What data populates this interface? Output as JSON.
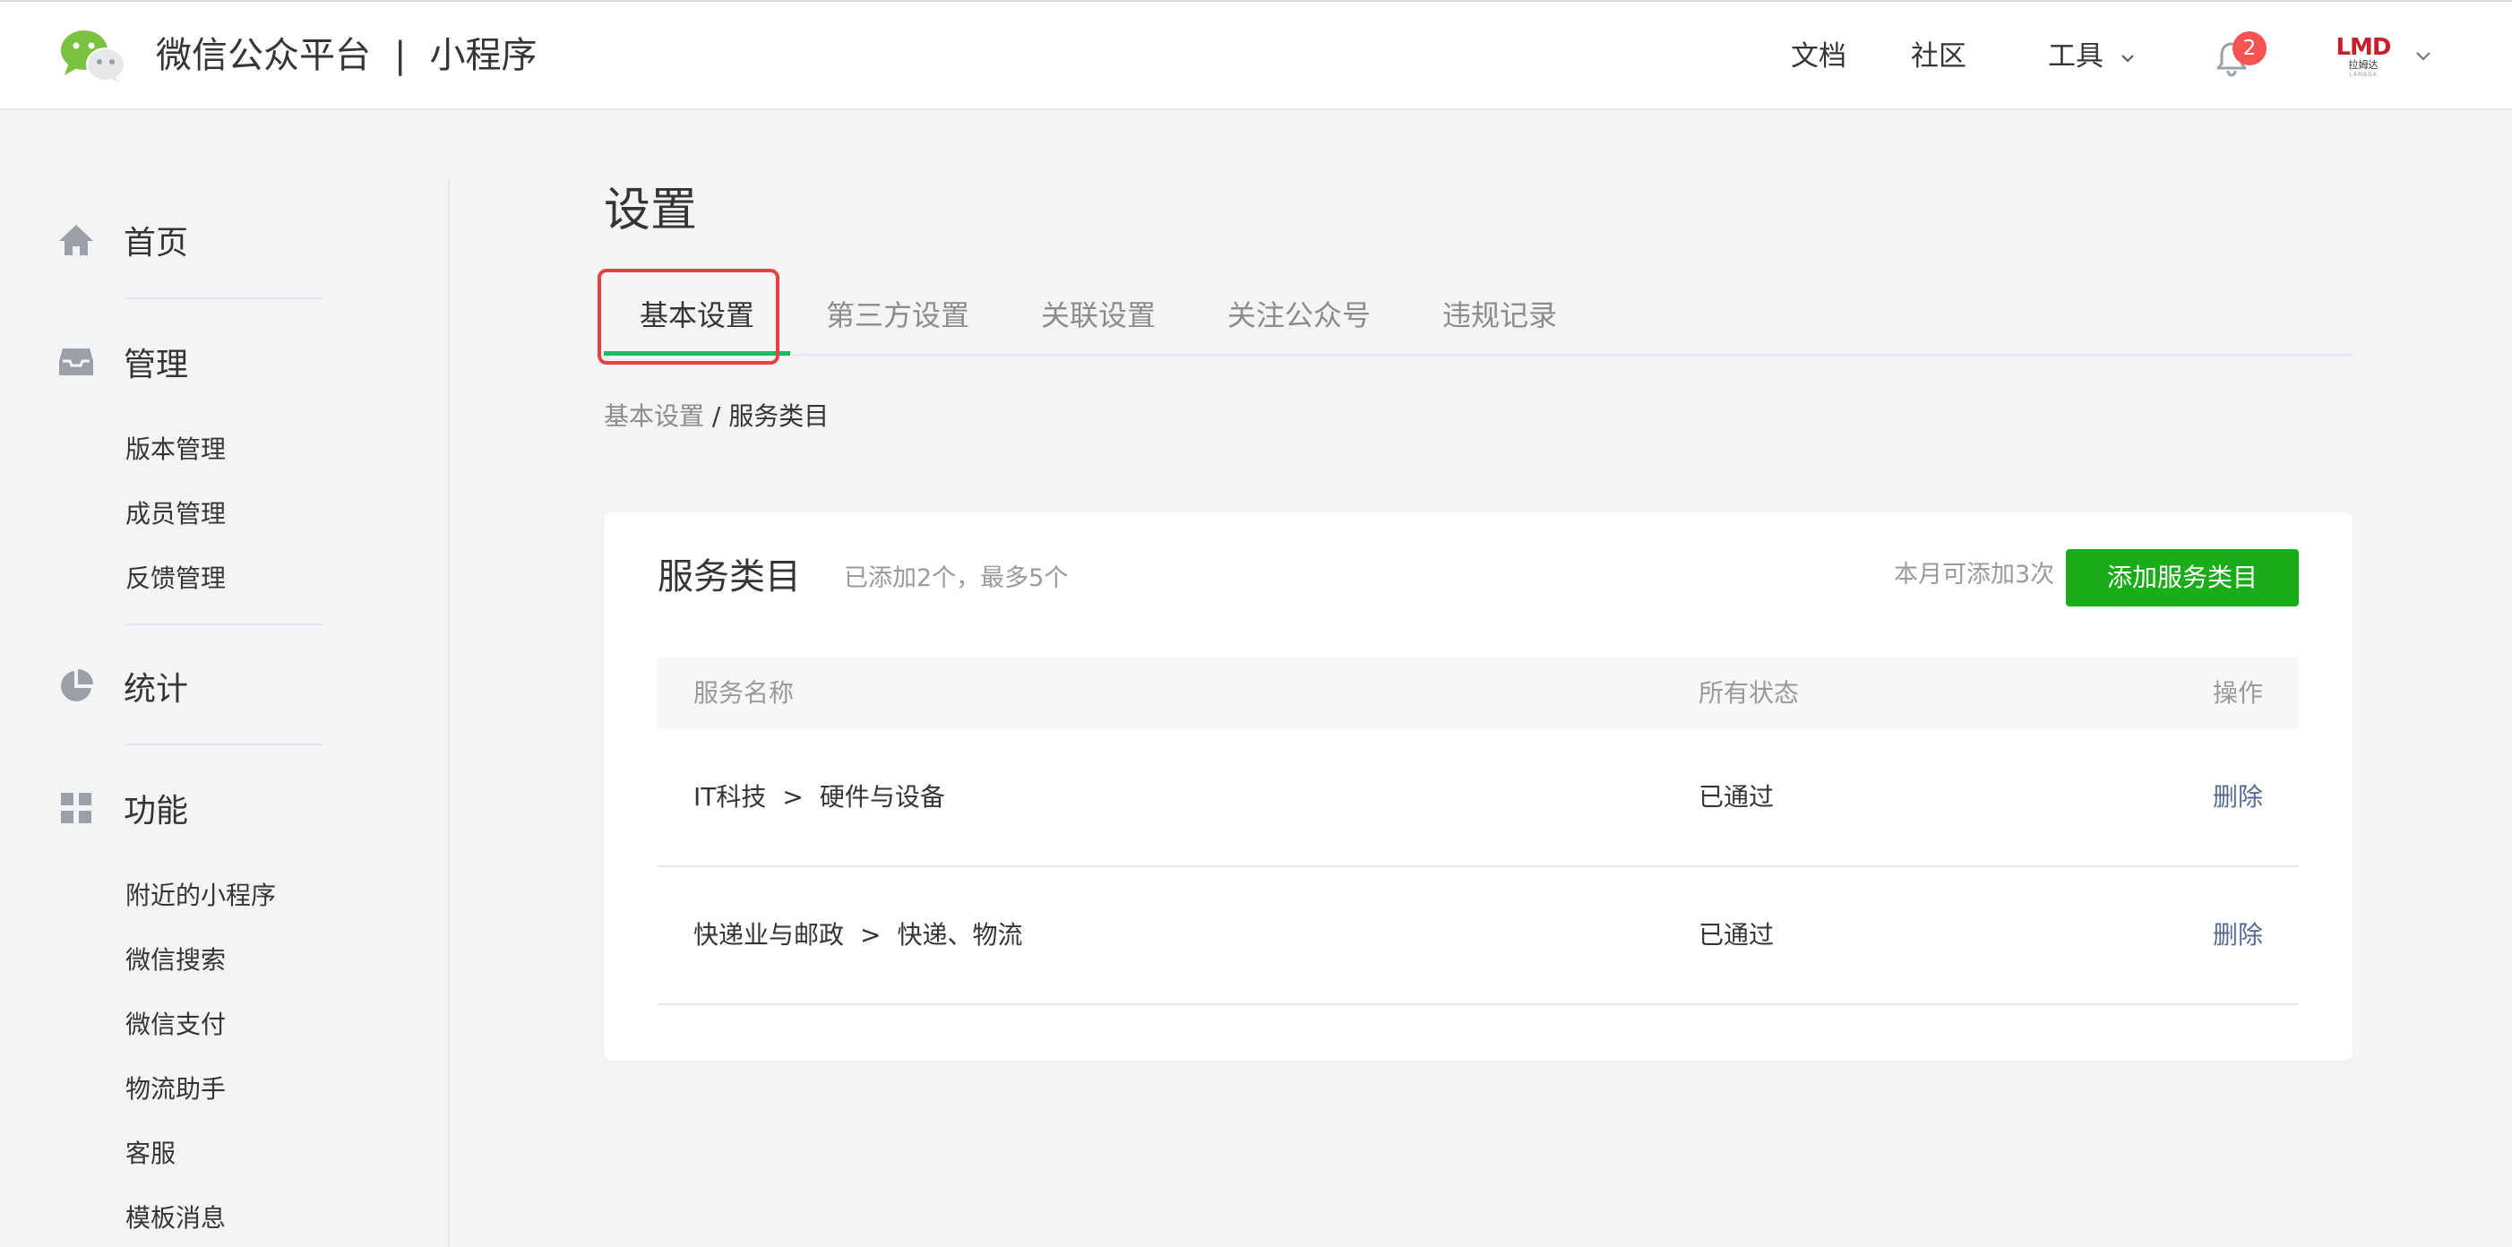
{
  "header": {
    "brand_title": "微信公众平台",
    "brand_sep": "|",
    "brand_product": "小程序",
    "nav": {
      "docs": "文档",
      "community": "社区",
      "tools": "工具"
    },
    "notifications_count": "2",
    "account_logo_text": "LMD",
    "account_logo_sub": "拉姆达",
    "account_logo_sub2": "LAMBDA"
  },
  "sidebar": {
    "home": "首页",
    "manage": "管理",
    "manage_items": [
      "版本管理",
      "成员管理",
      "反馈管理"
    ],
    "stats": "统计",
    "features": "功能",
    "feature_items": [
      "附近的小程序",
      "微信搜索",
      "微信支付",
      "物流助手",
      "客服",
      "模板消息"
    ]
  },
  "main": {
    "page_title": "设置",
    "tabs": [
      {
        "label": "基本设置",
        "active": true
      },
      {
        "label": "第三方设置",
        "active": false
      },
      {
        "label": "关联设置",
        "active": false
      },
      {
        "label": "关注公众号",
        "active": false
      },
      {
        "label": "违规记录",
        "active": false
      }
    ],
    "breadcrumb": {
      "parent": "基本设置",
      "separator": " / ",
      "current": "服务类目"
    },
    "card": {
      "title": "服务类目",
      "subtitle": "已添加2个，最多5个",
      "quota": "本月可添加3次",
      "add_button": "添加服务类目",
      "columns": {
        "name": "服务名称",
        "status": "所有状态",
        "action": "操作"
      },
      "rows": [
        {
          "category": "IT科技",
          "arrow": ">",
          "subcategory": "硬件与设备",
          "status": "已通过",
          "action": "删除"
        },
        {
          "category": "快递业与邮政",
          "arrow": ">",
          "subcategory": "快递、物流",
          "status": "已通过",
          "action": "删除"
        }
      ]
    }
  },
  "colors": {
    "accent_green": "#1aad19",
    "tab_underline": "#07c160",
    "highlight_red": "#e64340",
    "badge_red": "#fa5151",
    "link_blue": "#576b95",
    "page_bg": "#f3f4f6"
  },
  "icons": {
    "logo": "wechat-logo-icon",
    "bell": "bell-icon",
    "home": "home-icon",
    "manage": "inbox-icon",
    "stats": "pie-chart-icon",
    "features": "grid-icon",
    "caret": "chevron-down-icon"
  }
}
